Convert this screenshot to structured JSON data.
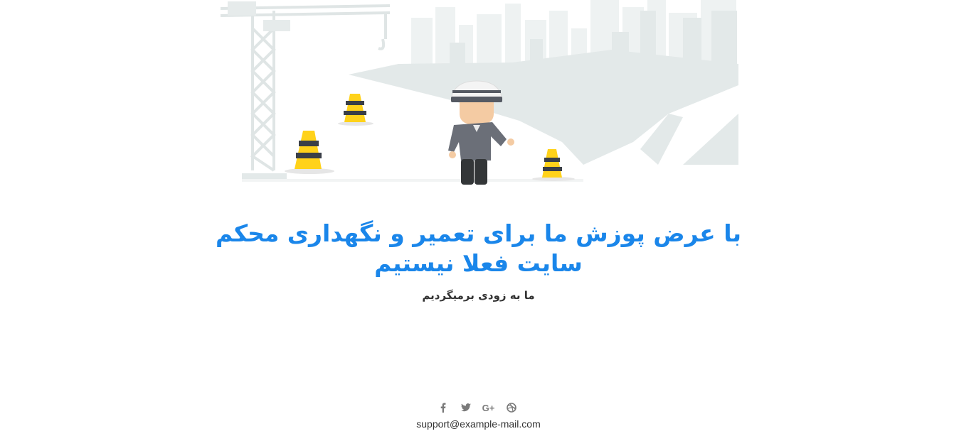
{
  "hero": {
    "alt": "construction worker with traffic cones and crane"
  },
  "headline": "با عرض پوزش ما برای تعمیر و نگهداری محکم سایت فعلا نیستیم",
  "subline": "ما به زودی برمیگردیم",
  "social": [
    {
      "icon": "facebook-icon",
      "glyph": "f"
    },
    {
      "icon": "twitter-icon",
      "glyph": ""
    },
    {
      "icon": "google-plus-icon",
      "glyph": "G+"
    },
    {
      "icon": "dribbble-icon",
      "glyph": ""
    }
  ],
  "contact": {
    "email": "support@example-mail.com"
  },
  "colors": {
    "accent": "#1a86ea",
    "cone": "#ffd21a",
    "stripe": "#3a3f47",
    "skyline": "#e9eeee"
  }
}
